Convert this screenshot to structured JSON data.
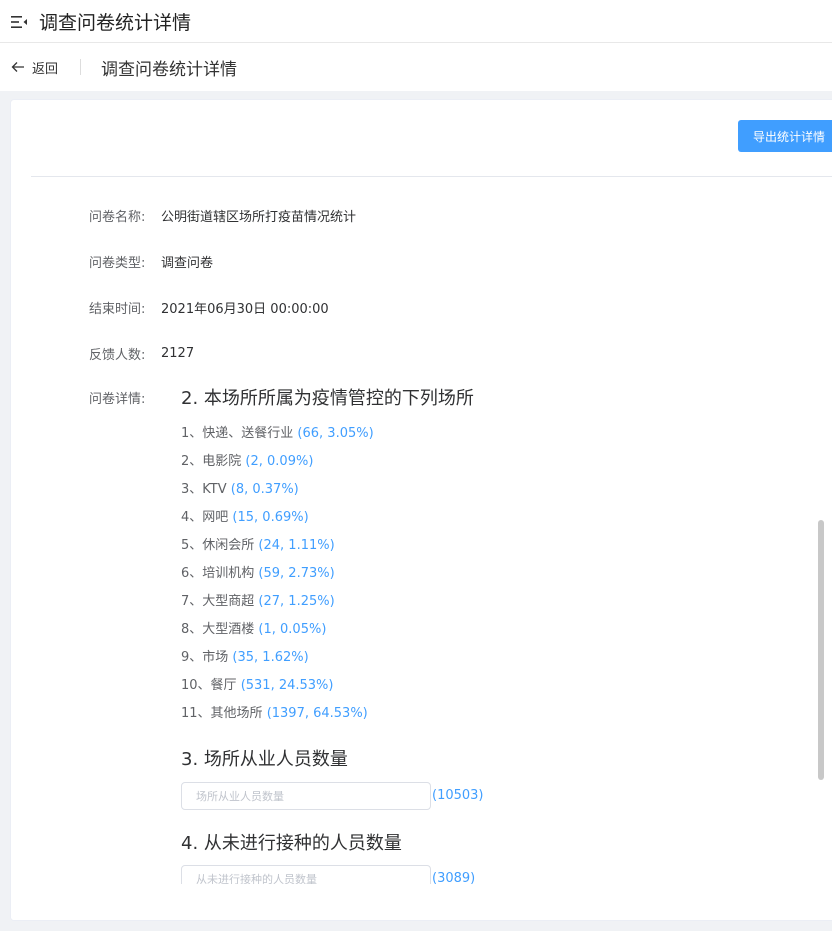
{
  "header": {
    "title": "调查问卷统计详情"
  },
  "nav": {
    "back_label": "返回",
    "title": "调查问卷统计详情"
  },
  "toolbar": {
    "export_label": "导出统计详情"
  },
  "info": [
    {
      "label": "问卷名称:",
      "value": "公明街道辖区场所打疫苗情况统计"
    },
    {
      "label": "问卷类型:",
      "value": "调查问卷"
    },
    {
      "label": "结束时间:",
      "value": "2021年06月30日 00:00:00"
    },
    {
      "label": "反馈人数:",
      "value": "2127"
    }
  ],
  "details_label": "问卷详情:",
  "questions": [
    {
      "title": "2. 本场所所属为疫情管控的下列场所",
      "options": [
        {
          "label": "1、快递、送餐行业",
          "stat": "(66, 3.05%)"
        },
        {
          "label": "2、电影院",
          "stat": "(2, 0.09%)"
        },
        {
          "label": "3、KTV",
          "stat": "(8, 0.37%)"
        },
        {
          "label": "4、网吧",
          "stat": "(15, 0.69%)"
        },
        {
          "label": "5、休闲会所",
          "stat": "(24, 1.11%)"
        },
        {
          "label": "6、培训机构",
          "stat": "(59, 2.73%)"
        },
        {
          "label": "7、大型商超",
          "stat": "(27, 1.25%)"
        },
        {
          "label": "8、大型酒楼",
          "stat": "(1, 0.05%)"
        },
        {
          "label": "9、市场",
          "stat": "(35, 1.62%)"
        },
        {
          "label": "10、餐厅",
          "stat": "(531, 24.53%)"
        },
        {
          "label": "11、其他场所",
          "stat": "(1397, 64.53%)"
        }
      ]
    },
    {
      "title": "3. 场所从业人员数量",
      "placeholder": "场所从业人员数量",
      "stat": "(10503)"
    },
    {
      "title": "4. 从未进行接种的人员数量",
      "placeholder": "从未进行接种的人员数量",
      "stat": "(3089)"
    }
  ],
  "colors": {
    "accent": "#409eff",
    "label": "#606266",
    "text": "#303133"
  }
}
